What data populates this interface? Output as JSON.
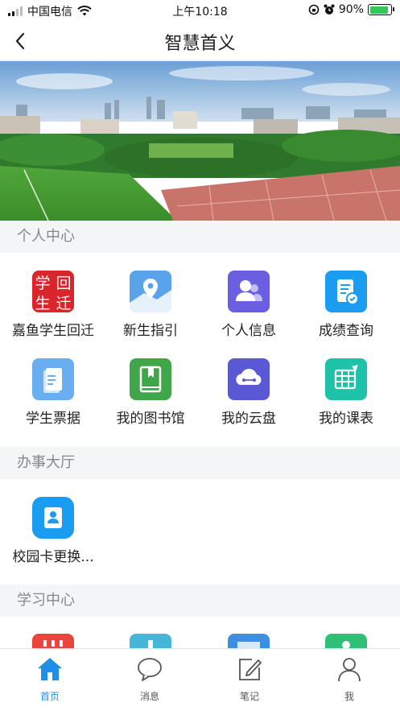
{
  "status_bar": {
    "carrier": "中国电信",
    "time": "上午10:18",
    "battery_percent": "90%",
    "battery_level": 0.9
  },
  "nav": {
    "title": "智慧首义"
  },
  "sections": {
    "personal": {
      "title": "个人中心",
      "items": [
        {
          "label": "嘉鱼学生回迁",
          "icon": "student-return-seal-icon",
          "color": "#d8262c",
          "badge_chars": [
            "学",
            "回",
            "生",
            "迁"
          ]
        },
        {
          "label": "新生指引",
          "icon": "location-map-icon",
          "color": "#5aa3ea"
        },
        {
          "label": "个人信息",
          "icon": "user-profile-icon",
          "color": "#6a5fe0"
        },
        {
          "label": "成绩查询",
          "icon": "grade-report-icon",
          "color": "#1a9cf0"
        },
        {
          "label": "学生票据",
          "icon": "receipt-document-icon",
          "color": "#6aaef2"
        },
        {
          "label": "我的图书馆",
          "icon": "library-book-icon",
          "color": "#3fa64a"
        },
        {
          "label": "我的云盘",
          "icon": "cloud-drive-icon",
          "color": "#5b58d6"
        },
        {
          "label": "我的课表",
          "icon": "timetable-icon",
          "color": "#1ec2a8"
        }
      ]
    },
    "office": {
      "title": "办事大厅",
      "items": [
        {
          "label": "校园卡更换...",
          "icon": "campus-card-icon",
          "color": "#1a9cf0"
        }
      ]
    },
    "study": {
      "title": "学习中心",
      "items": [
        {
          "icon": "calendar-icon",
          "color": "#e8453c"
        },
        {
          "icon": "student-icon",
          "color": "#45b5d8"
        },
        {
          "icon": "screen-icon",
          "color": "#3d8fe0"
        },
        {
          "icon": "person-icon",
          "color": "#2fbf77"
        }
      ]
    }
  },
  "tabs": [
    {
      "label": "首页",
      "icon": "home-icon",
      "active": true
    },
    {
      "label": "消息",
      "icon": "message-icon",
      "active": false
    },
    {
      "label": "笔记",
      "icon": "note-edit-icon",
      "active": false
    },
    {
      "label": "我",
      "icon": "person-icon",
      "active": false
    }
  ],
  "colors": {
    "accent": "#1f8fe6",
    "section_bg": "#f4f5f7"
  }
}
